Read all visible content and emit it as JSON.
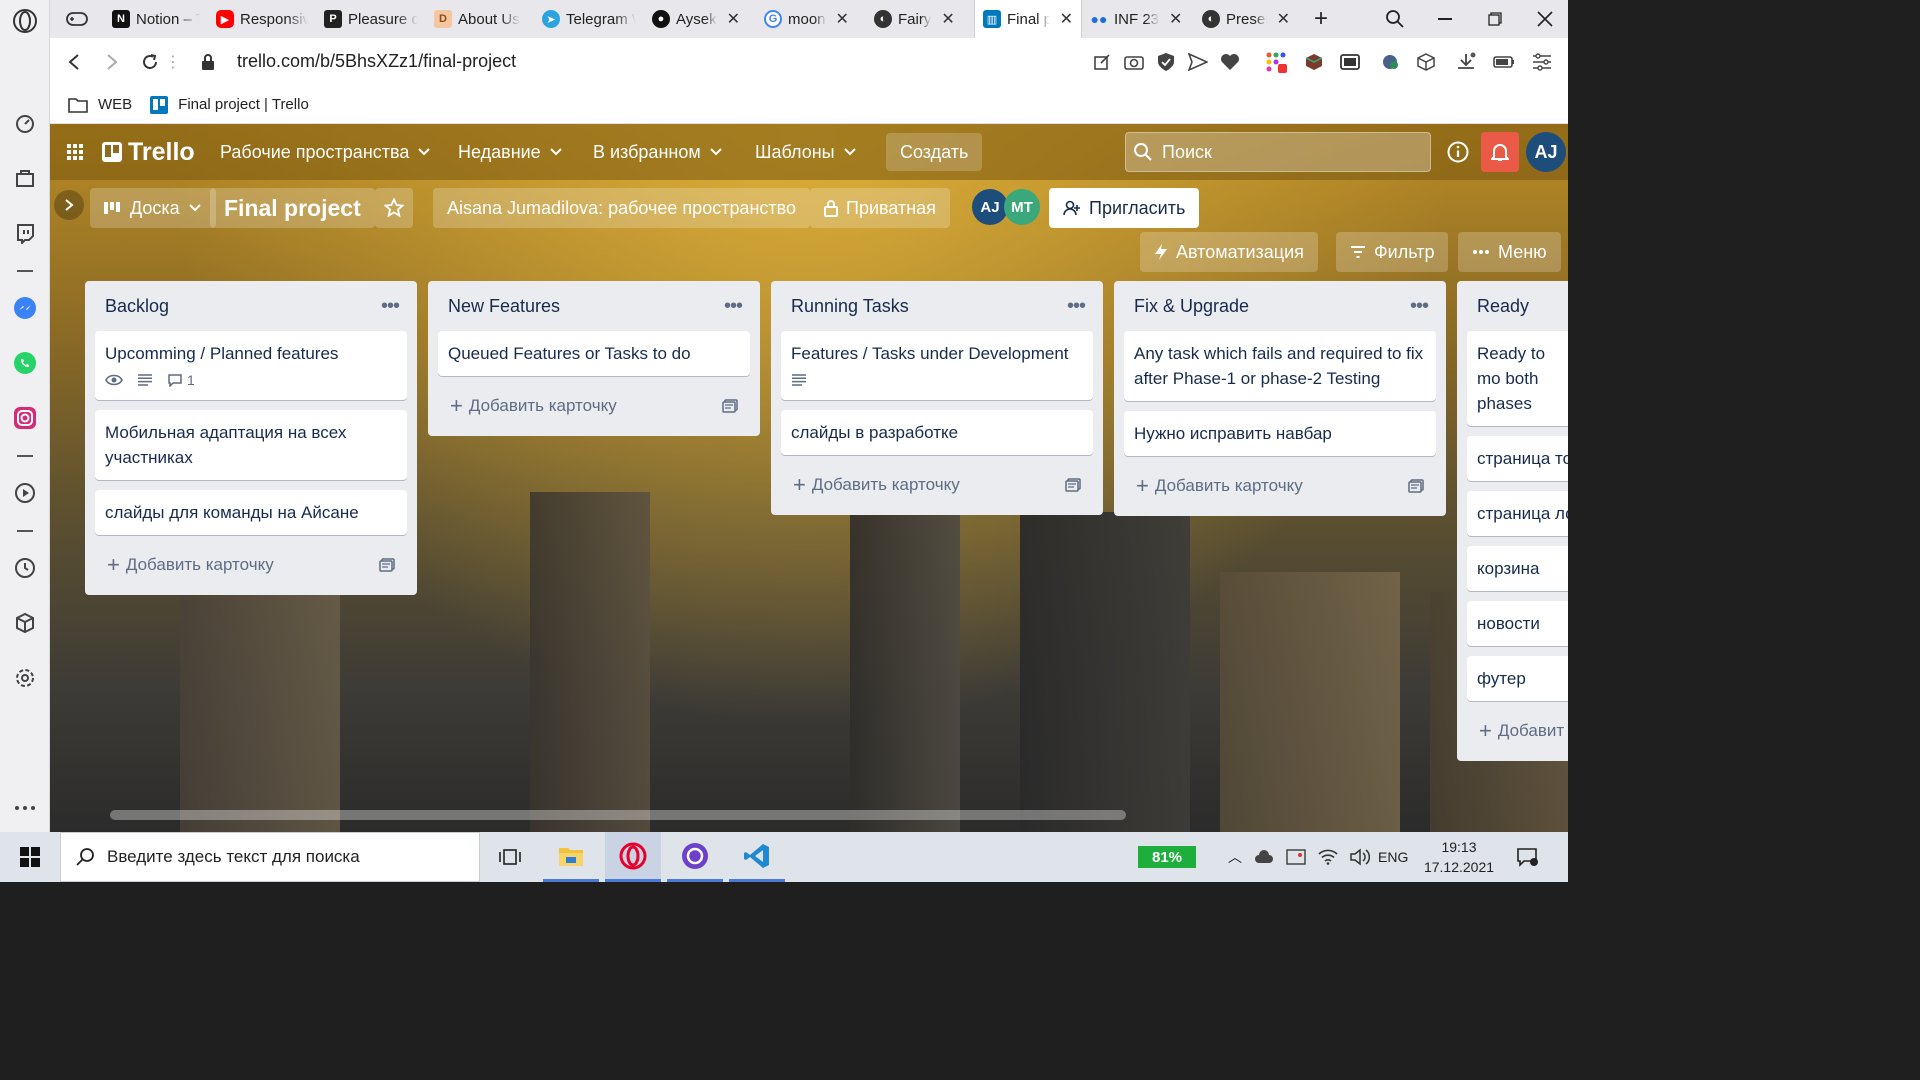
{
  "browser": {
    "tabs": [
      {
        "label": "Notion – T",
        "icon": "notion-icon",
        "active": false
      },
      {
        "label": "Responsiv",
        "icon": "youtube-icon",
        "active": false
      },
      {
        "label": "Pleasure o",
        "icon": "p-icon",
        "active": false
      },
      {
        "label": "About Us",
        "icon": "d-icon",
        "active": false
      },
      {
        "label": "Telegram W",
        "icon": "telegram-icon",
        "active": false
      },
      {
        "label": "Aysek",
        "icon": "github-icon",
        "active": false
      },
      {
        "label": "moon",
        "icon": "google-icon",
        "active": false
      },
      {
        "label": "Fairy",
        "icon": "web-icon",
        "active": false
      },
      {
        "label": "Final p",
        "icon": "trello-icon",
        "active": true
      },
      {
        "label": "INF 23",
        "icon": "dots-icon",
        "active": false
      },
      {
        "label": "Presen",
        "icon": "web-icon",
        "active": false
      }
    ],
    "url": "trello.com/b/5BhsXZz1/final-project",
    "bookmarks": [
      {
        "label": "WEB",
        "icon": "folder-icon"
      },
      {
        "label": "Final project | Trello",
        "icon": "trello-icon"
      }
    ]
  },
  "trello": {
    "logo": "Trello",
    "nav": {
      "workspaces": "Рабочие пространства",
      "recent": "Недавние",
      "starred": "В избранном",
      "templates": "Шаблоны",
      "create": "Создать"
    },
    "search_placeholder": "Поиск",
    "avatar": "AJ",
    "board": {
      "view": "Доска",
      "title": "Final project",
      "workspace": "Aisana Jumadilova: рабочее пространство",
      "visibility": "Приватная",
      "members": [
        "AJ",
        "MT"
      ],
      "invite": "Пригласить",
      "automation": "Автоматизация",
      "filter": "Фильтр",
      "menu": "Меню",
      "add_card": "Добавить карточку",
      "add_card_partial": "Добавит",
      "lists": [
        {
          "name": "Backlog",
          "cards": [
            {
              "text": "Upcomming / Planned features",
              "watch": true,
              "description": true,
              "comments": "1"
            },
            {
              "text": "Мобильная адаптация на всех участниках"
            },
            {
              "text": "слайды для команды на Айсане"
            }
          ]
        },
        {
          "name": "New Features",
          "cards": [
            {
              "text": "Queued Features or Tasks to do"
            }
          ]
        },
        {
          "name": "Running Tasks",
          "cards": [
            {
              "text": "Features / Tasks under Development",
              "description": true
            },
            {
              "text": "слайды в разработке"
            }
          ]
        },
        {
          "name": "Fix & Upgrade",
          "cards": [
            {
              "text": "Any task which fails and required to fix after Phase-1 or phase-2 Testing"
            },
            {
              "text": "Нужно исправить навбар"
            }
          ]
        },
        {
          "name": "Ready",
          "cards": [
            {
              "text": "Ready to mo both phases"
            },
            {
              "text": "страница то"
            },
            {
              "text": "страница ло"
            },
            {
              "text": "корзина"
            },
            {
              "text": "новости"
            },
            {
              "text": "футер"
            }
          ]
        }
      ]
    }
  },
  "taskbar": {
    "search_placeholder": "Введите здесь текст для поиска",
    "battery": "81%",
    "language": "ENG",
    "time": "19:13",
    "date": "17.12.2021"
  }
}
